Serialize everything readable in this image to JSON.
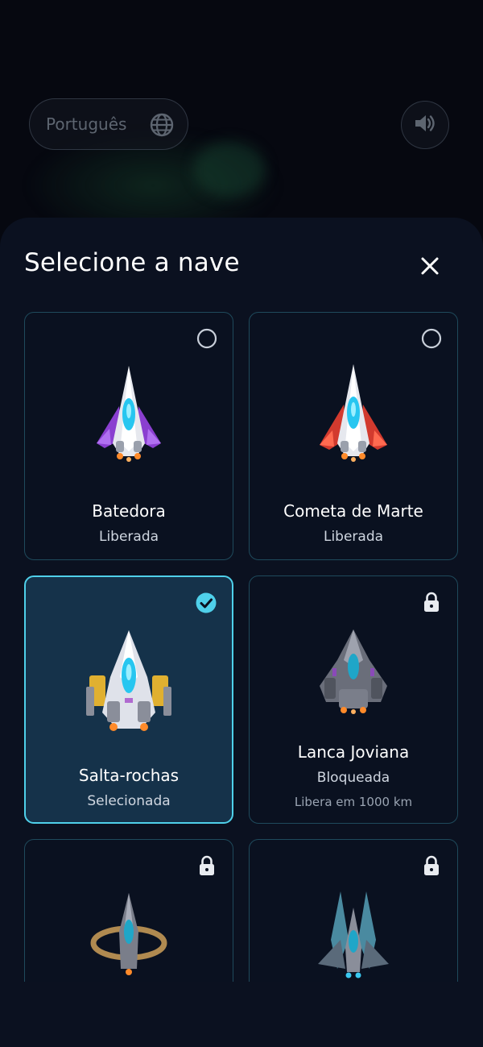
{
  "header": {
    "language_label": "Português",
    "globe_icon": "globe-icon",
    "sound_icon": "speaker-icon"
  },
  "sheet": {
    "title": "Selecione a nave",
    "close_icon": "close-icon"
  },
  "ships": [
    {
      "name": "Batedora",
      "status": "Liberada",
      "hint": "",
      "state": "unlocked",
      "wing_color": "#8a3fd0"
    },
    {
      "name": "Cometa de Marte",
      "status": "Liberada",
      "hint": "",
      "state": "unlocked",
      "wing_color": "#d23a2e"
    },
    {
      "name": "Salta-rochas",
      "status": "Selecionada",
      "hint": "",
      "state": "selected",
      "wing_color": "#e0b030"
    },
    {
      "name": "Lanca Joviana",
      "status": "Bloqueada",
      "hint": "Libera em 1000 km",
      "state": "locked",
      "wing_color": "#6a6e7a"
    },
    {
      "name": "",
      "status": "",
      "hint": "",
      "state": "locked",
      "wing_color": "#b08a50"
    },
    {
      "name": "",
      "status": "",
      "hint": "",
      "state": "locked",
      "wing_color": "#4a8aa0"
    }
  ],
  "colors": {
    "accent": "#4fd0ea",
    "card_border": "#1f4a5c",
    "sheet_bg": "#0b1120"
  }
}
